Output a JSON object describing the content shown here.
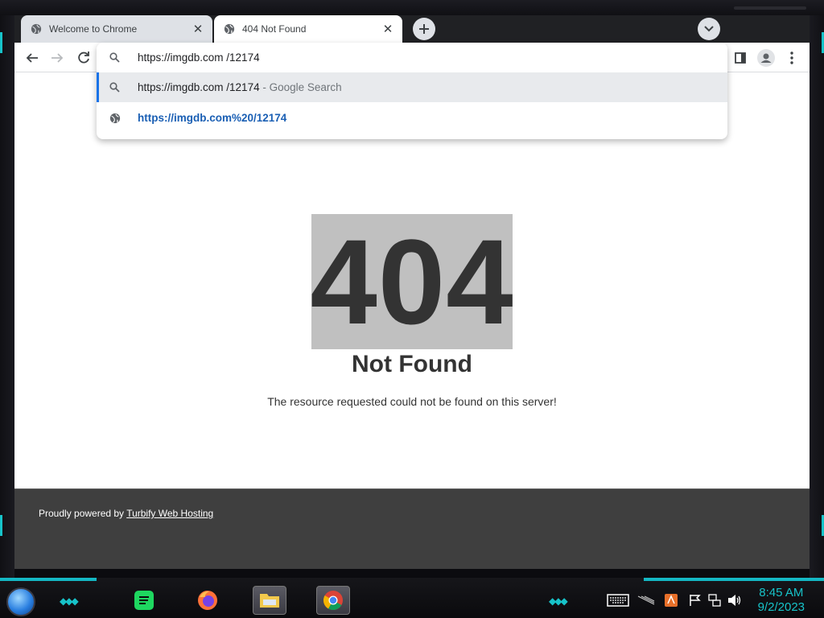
{
  "tabs": [
    {
      "title": "Welcome to Chrome",
      "active": false
    },
    {
      "title": "404 Not Found",
      "active": true
    }
  ],
  "omnibox": {
    "input_value": "https://imgdb.com /12174",
    "suggestions": [
      {
        "text": "https://imgdb.com /12174",
        "suffix": " - Google Search",
        "icon": "search-icon"
      },
      {
        "text": "https://imgdb.com%20/12174",
        "suffix": "",
        "icon": "globe-icon"
      }
    ]
  },
  "page": {
    "code": "404",
    "title": "Not Found",
    "message": "The resource requested could not be found on this server!",
    "footer_prefix": "Proudly powered by ",
    "footer_link": "Turbify Web Hosting"
  },
  "taskbar": {
    "apps": [
      "spotify",
      "firefox",
      "file-explorer",
      "chrome"
    ],
    "clock_time": "8:45 AM",
    "clock_date": "9/2/2023"
  },
  "colors": {
    "accent": "#17c3c9",
    "link_blue": "#1a5fb4",
    "selection_bar": "#1a73e8"
  }
}
